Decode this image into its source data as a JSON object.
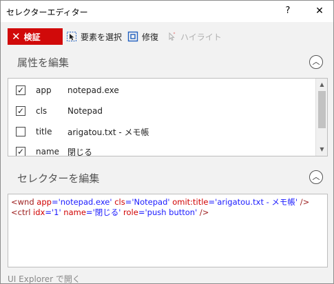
{
  "window": {
    "title": "セレクターエディター",
    "help_label": "?",
    "close_label": "✕"
  },
  "toolbar": {
    "verify_label": "検証",
    "select_element_label": "要素を選択",
    "repair_label": "修復",
    "highlight_label": "ハイライト"
  },
  "attributes_section": {
    "title": "属性を編集",
    "items": [
      {
        "checked": true,
        "check_mark": "✓",
        "name": "app",
        "value": "notepad.exe"
      },
      {
        "checked": true,
        "check_mark": "✓",
        "name": "cls",
        "value": "Notepad"
      },
      {
        "checked": false,
        "check_mark": "",
        "name": "title",
        "value": "arigatou.txt - メモ帳"
      },
      {
        "checked": true,
        "check_mark": "✓",
        "name": "name",
        "value": "閉じる"
      }
    ]
  },
  "selector_section": {
    "title": "セレクターを編集",
    "line1": {
      "open": "<wnd ",
      "a1": "app",
      "v1": "'notepad.exe'",
      "a2": "cls",
      "v2": "'Notepad'",
      "a3": "omit:title",
      "v3": "'arigatou.txt - メモ帳'",
      "close": "/>"
    },
    "line2": {
      "open": "<ctrl ",
      "a1": "idx",
      "v1": "'1'",
      "a2": "name",
      "v2": "'閉じる'",
      "a3": "role",
      "v3": "'push button'",
      "close": "/>"
    }
  },
  "footer": {
    "link_label": "UI Explorer で開く"
  },
  "colors": {
    "verify_bg": "#d10a0a",
    "tag_color": "#9b1b1b",
    "attr_color": "#d00000",
    "value_color": "#1a1aff"
  },
  "icons": {
    "verify": "close-x-icon",
    "select": "cursor-select-icon",
    "repair": "target-square-icon",
    "highlight": "highlight-cursor-icon",
    "collapse": "chevron-up-icon"
  }
}
